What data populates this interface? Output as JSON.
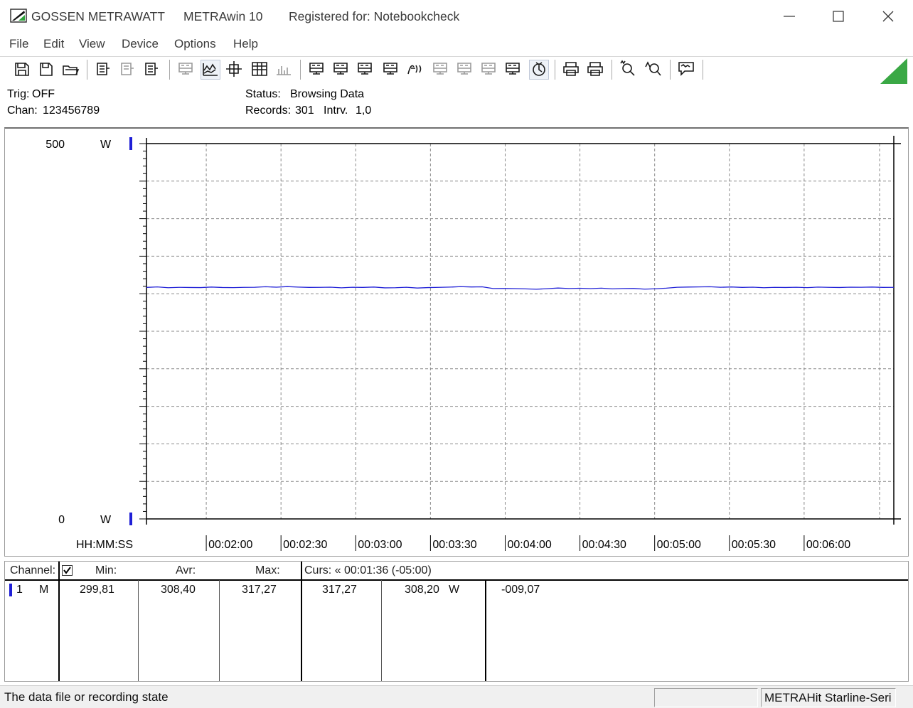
{
  "window": {
    "brand": "GOSSEN METRAWATT",
    "app_name": "METRAwin 10",
    "registered": "Registered for: Notebookcheck"
  },
  "menu": [
    "File",
    "Edit",
    "View",
    "Device",
    "Options",
    "Help"
  ],
  "toolbar_icons": [
    "save-as-icon",
    "save-icon",
    "open-folder-icon",
    "device-read-icon",
    "device-config-icon",
    "device-send-icon",
    "print-preview-icon",
    "line-graph-icon",
    "crosshair-icon",
    "table-view-icon",
    "bar-graph-icon",
    "export-icon",
    "import-icon",
    "list-icon",
    "computer-icon",
    "function-icon",
    "memory-icon",
    "waveform-icon",
    "zigzag-icon",
    "settings-icon",
    "acquire-icon",
    "printer-setup-icon",
    "print-icon",
    "zoom-in-icon",
    "zoom-out-icon",
    "comment-icon"
  ],
  "info": {
    "trig_label": "Trig:",
    "trig_value": "OFF",
    "chan_label": "Chan:",
    "chan_value": "123456789",
    "status_label": "Status:",
    "status_value": "Browsing Data",
    "records_label": "Records:",
    "records_value": "301",
    "intrv_label": "Intrv.",
    "intrv_value": "1,0"
  },
  "chart_data": {
    "type": "line",
    "xlabel": "HH:MM:SS",
    "ylim": [
      0,
      500
    ],
    "y_unit": "W",
    "y_tick_labels": [
      "500",
      "0"
    ],
    "x_tick_labels": [
      "00:02:00",
      "00:02:30",
      "00:03:00",
      "00:03:30",
      "00:04:00",
      "00:04:30",
      "00:05:00",
      "00:05:30",
      "00:06:00"
    ],
    "grid": true,
    "series": [
      {
        "color": "#1f1fd6",
        "x_range_s": [
          96,
          396
        ],
        "values": [
          308.4,
          309.1,
          308.0,
          308.5,
          308.3,
          308.2,
          308.9,
          308.3,
          308.1,
          308.5,
          308.6,
          309.3,
          308.7,
          309.5,
          308.8,
          308.4,
          308.5,
          308.7,
          307.9,
          308.6,
          308.4,
          308.9,
          307.8,
          308.0,
          308.6,
          307.6,
          308.2,
          308.5,
          308.8,
          309.4,
          309.0,
          309.2,
          306.9,
          307.0,
          306.8,
          306.5,
          306.0,
          306.7,
          307.6,
          306.9,
          307.3,
          306.8,
          307.4,
          306.5,
          306.9,
          307.0,
          306.1,
          306.6,
          307.4,
          308.6,
          308.9,
          309.1,
          309.3,
          308.6,
          309.0,
          308.4,
          308.7,
          308.0,
          308.5,
          308.3,
          308.6,
          308.1,
          308.8,
          308.5,
          308.3,
          308.7,
          308.6,
          308.9,
          308.4,
          308.5
        ]
      }
    ]
  },
  "table": {
    "headers": {
      "channel": "Channel:",
      "min": "Min:",
      "avr": "Avr:",
      "max": "Max:",
      "curs": "Curs: « 00:01:36 (-05:00)"
    },
    "row": {
      "channel_num": "1",
      "mode": "M",
      "min": "299,81",
      "avr": "308,40",
      "max": "317,27",
      "curs1": "317,27",
      "curs2": "308,20",
      "unit": "W",
      "diff": "-009,07"
    }
  },
  "statusbar": {
    "message": "The data file or recording state",
    "device": "METRAHit Starline-Seri"
  }
}
